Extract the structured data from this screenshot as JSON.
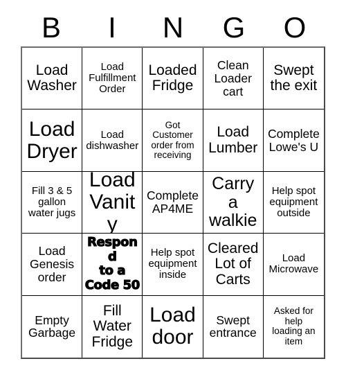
{
  "card": {
    "header_letters": [
      "B",
      "I",
      "N",
      "G",
      "O"
    ],
    "columns": 5,
    "rows": 5,
    "background_color": "#ffffff",
    "text_color": "#000000",
    "border_color": "#000000",
    "cells": [
      {
        "text": "Load\nWasher",
        "size": "lg",
        "style": "normal"
      },
      {
        "text": "Load\nFulfillment\nOrder",
        "size": "sm",
        "style": "normal"
      },
      {
        "text": "Loaded\nFridge",
        "size": "lg",
        "style": "normal"
      },
      {
        "text": "Clean\nLoader\ncart",
        "size": "md",
        "style": "normal"
      },
      {
        "text": "Swept\nthe exit",
        "size": "lg",
        "style": "normal"
      },
      {
        "text": "Load\nDryer",
        "size": "xxl",
        "style": "normal"
      },
      {
        "text": "Load\ndishwasher",
        "size": "sm",
        "style": "normal"
      },
      {
        "text": "Got\nCustomer\norder from\nreceiving",
        "size": "xs",
        "style": "normal"
      },
      {
        "text": "Load\nLumber",
        "size": "lg",
        "style": "normal"
      },
      {
        "text": "Complete\nLowe's U",
        "size": "md",
        "style": "normal"
      },
      {
        "text": "Fill 3 & 5\ngallon\nwater jugs",
        "size": "sm",
        "style": "normal"
      },
      {
        "text": "Load\nVanity",
        "size": "xxl",
        "style": "normal"
      },
      {
        "text": "Complete\nAP4ME",
        "size": "md",
        "style": "normal"
      },
      {
        "text": "Carry a\nwalkie",
        "size": "xl",
        "style": "normal"
      },
      {
        "text": "Help spot\nequipment\noutside",
        "size": "sm",
        "style": "normal"
      },
      {
        "text": "Load\nGenesis\norder",
        "size": "md",
        "style": "normal"
      },
      {
        "text": "Respond\nto a\nCode 50",
        "size": "md",
        "style": "heavy"
      },
      {
        "text": "Help spot\nequipment\ninside",
        "size": "sm",
        "style": "normal"
      },
      {
        "text": "Cleared\nLot of\nCarts",
        "size": "lg",
        "style": "normal"
      },
      {
        "text": "Load\nMicrowave",
        "size": "sm",
        "style": "normal"
      },
      {
        "text": "Empty\nGarbage",
        "size": "md",
        "style": "normal"
      },
      {
        "text": "Fill\nWater\nFridge",
        "size": "lg",
        "style": "normal"
      },
      {
        "text": "Load\ndoor",
        "size": "xxl",
        "style": "normal"
      },
      {
        "text": "Swept\nentrance",
        "size": "md",
        "style": "normal"
      },
      {
        "text": "Asked for\nhelp\nloading an\nitem",
        "size": "xs",
        "style": "normal"
      }
    ]
  }
}
